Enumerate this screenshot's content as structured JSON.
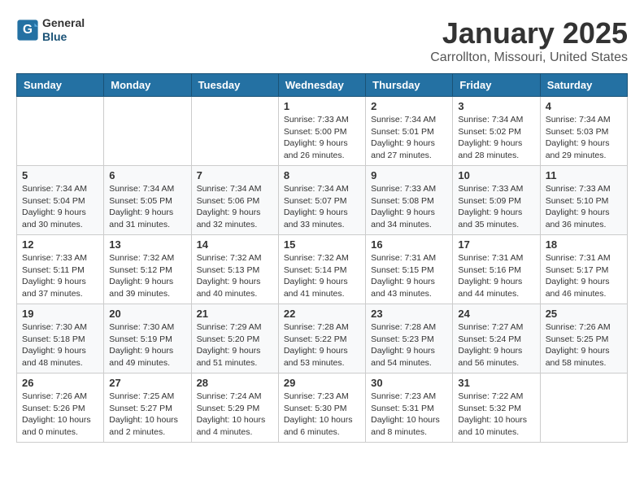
{
  "header": {
    "logo_general": "General",
    "logo_blue": "Blue",
    "month_title": "January 2025",
    "location": "Carrollton, Missouri, United States"
  },
  "weekdays": [
    "Sunday",
    "Monday",
    "Tuesday",
    "Wednesday",
    "Thursday",
    "Friday",
    "Saturday"
  ],
  "weeks": [
    [
      {
        "day": "",
        "info": ""
      },
      {
        "day": "",
        "info": ""
      },
      {
        "day": "",
        "info": ""
      },
      {
        "day": "1",
        "info": "Sunrise: 7:33 AM\nSunset: 5:00 PM\nDaylight: 9 hours and 26 minutes."
      },
      {
        "day": "2",
        "info": "Sunrise: 7:34 AM\nSunset: 5:01 PM\nDaylight: 9 hours and 27 minutes."
      },
      {
        "day": "3",
        "info": "Sunrise: 7:34 AM\nSunset: 5:02 PM\nDaylight: 9 hours and 28 minutes."
      },
      {
        "day": "4",
        "info": "Sunrise: 7:34 AM\nSunset: 5:03 PM\nDaylight: 9 hours and 29 minutes."
      }
    ],
    [
      {
        "day": "5",
        "info": "Sunrise: 7:34 AM\nSunset: 5:04 PM\nDaylight: 9 hours and 30 minutes."
      },
      {
        "day": "6",
        "info": "Sunrise: 7:34 AM\nSunset: 5:05 PM\nDaylight: 9 hours and 31 minutes."
      },
      {
        "day": "7",
        "info": "Sunrise: 7:34 AM\nSunset: 5:06 PM\nDaylight: 9 hours and 32 minutes."
      },
      {
        "day": "8",
        "info": "Sunrise: 7:34 AM\nSunset: 5:07 PM\nDaylight: 9 hours and 33 minutes."
      },
      {
        "day": "9",
        "info": "Sunrise: 7:33 AM\nSunset: 5:08 PM\nDaylight: 9 hours and 34 minutes."
      },
      {
        "day": "10",
        "info": "Sunrise: 7:33 AM\nSunset: 5:09 PM\nDaylight: 9 hours and 35 minutes."
      },
      {
        "day": "11",
        "info": "Sunrise: 7:33 AM\nSunset: 5:10 PM\nDaylight: 9 hours and 36 minutes."
      }
    ],
    [
      {
        "day": "12",
        "info": "Sunrise: 7:33 AM\nSunset: 5:11 PM\nDaylight: 9 hours and 37 minutes."
      },
      {
        "day": "13",
        "info": "Sunrise: 7:32 AM\nSunset: 5:12 PM\nDaylight: 9 hours and 39 minutes."
      },
      {
        "day": "14",
        "info": "Sunrise: 7:32 AM\nSunset: 5:13 PM\nDaylight: 9 hours and 40 minutes."
      },
      {
        "day": "15",
        "info": "Sunrise: 7:32 AM\nSunset: 5:14 PM\nDaylight: 9 hours and 41 minutes."
      },
      {
        "day": "16",
        "info": "Sunrise: 7:31 AM\nSunset: 5:15 PM\nDaylight: 9 hours and 43 minutes."
      },
      {
        "day": "17",
        "info": "Sunrise: 7:31 AM\nSunset: 5:16 PM\nDaylight: 9 hours and 44 minutes."
      },
      {
        "day": "18",
        "info": "Sunrise: 7:31 AM\nSunset: 5:17 PM\nDaylight: 9 hours and 46 minutes."
      }
    ],
    [
      {
        "day": "19",
        "info": "Sunrise: 7:30 AM\nSunset: 5:18 PM\nDaylight: 9 hours and 48 minutes."
      },
      {
        "day": "20",
        "info": "Sunrise: 7:30 AM\nSunset: 5:19 PM\nDaylight: 9 hours and 49 minutes."
      },
      {
        "day": "21",
        "info": "Sunrise: 7:29 AM\nSunset: 5:20 PM\nDaylight: 9 hours and 51 minutes."
      },
      {
        "day": "22",
        "info": "Sunrise: 7:28 AM\nSunset: 5:22 PM\nDaylight: 9 hours and 53 minutes."
      },
      {
        "day": "23",
        "info": "Sunrise: 7:28 AM\nSunset: 5:23 PM\nDaylight: 9 hours and 54 minutes."
      },
      {
        "day": "24",
        "info": "Sunrise: 7:27 AM\nSunset: 5:24 PM\nDaylight: 9 hours and 56 minutes."
      },
      {
        "day": "25",
        "info": "Sunrise: 7:26 AM\nSunset: 5:25 PM\nDaylight: 9 hours and 58 minutes."
      }
    ],
    [
      {
        "day": "26",
        "info": "Sunrise: 7:26 AM\nSunset: 5:26 PM\nDaylight: 10 hours and 0 minutes."
      },
      {
        "day": "27",
        "info": "Sunrise: 7:25 AM\nSunset: 5:27 PM\nDaylight: 10 hours and 2 minutes."
      },
      {
        "day": "28",
        "info": "Sunrise: 7:24 AM\nSunset: 5:29 PM\nDaylight: 10 hours and 4 minutes."
      },
      {
        "day": "29",
        "info": "Sunrise: 7:23 AM\nSunset: 5:30 PM\nDaylight: 10 hours and 6 minutes."
      },
      {
        "day": "30",
        "info": "Sunrise: 7:23 AM\nSunset: 5:31 PM\nDaylight: 10 hours and 8 minutes."
      },
      {
        "day": "31",
        "info": "Sunrise: 7:22 AM\nSunset: 5:32 PM\nDaylight: 10 hours and 10 minutes."
      },
      {
        "day": "",
        "info": ""
      }
    ]
  ]
}
